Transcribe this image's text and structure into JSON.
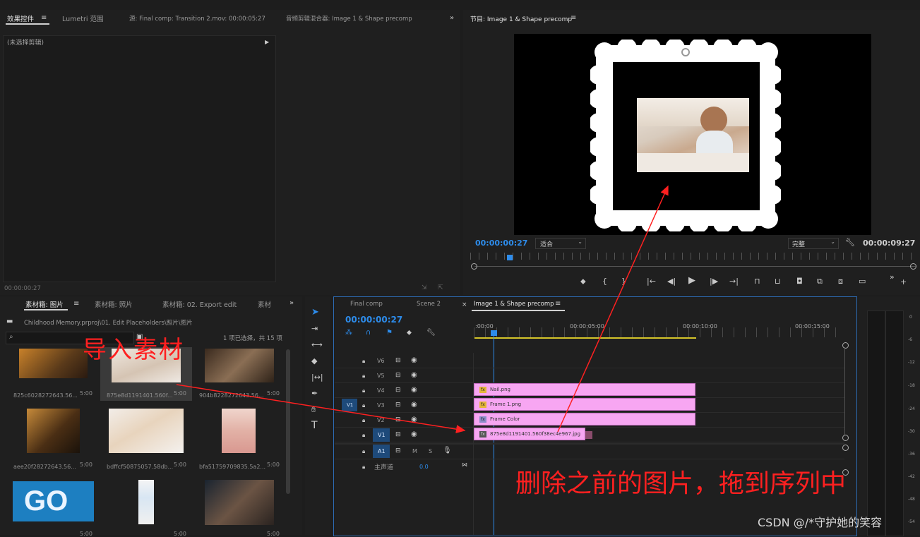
{
  "effect_panel": {
    "tabs": [
      "效果控件",
      "Lumetri 范围",
      "源: Final comp: Transition 2.mov: 00:00:05:27",
      "音频剪辑混合器: Image 1 & Shape precomp"
    ],
    "no_clip": "(未选择剪辑)",
    "timecode": "00:00:00:27"
  },
  "program": {
    "title": "节目: Image 1 & Shape precomp",
    "timecode": "00:00:00:27",
    "fit": "适合",
    "quality": "完整",
    "duration": "00:00:09:27"
  },
  "project": {
    "tabs": [
      "素材箱: 图片",
      "素材箱: 照片",
      "素材箱: 02. Export edit",
      "素材"
    ],
    "path": "Childhood Memory.prproj\\01. Edit Placeholders\\照片\\图片",
    "selection": "1 项已选择，共 15 项",
    "items": [
      {
        "name": "825c6028272643.56...",
        "dur": "5:00"
      },
      {
        "name": "875e8d1191401.560f...",
        "dur": "5:00"
      },
      {
        "name": "904b8228272643.56...",
        "dur": "5:00"
      },
      {
        "name": "aee20f28272643.56...",
        "dur": "5:00"
      },
      {
        "name": "bdffcf50875057.58db...",
        "dur": "5:00"
      },
      {
        "name": "bfa51759709835.5a2...",
        "dur": "5:00"
      },
      {
        "name": "",
        "dur": "5:00"
      },
      {
        "name": "",
        "dur": "5:00"
      },
      {
        "name": "",
        "dur": "5:00"
      }
    ]
  },
  "timeline": {
    "tabs": [
      "Final comp",
      "Scene 2",
      "Image 1 & Shape precomp"
    ],
    "timecode": "00:00:00:27",
    "ruler": [
      ":00:00",
      "00:00:05:00",
      "00:00:10:00",
      "00:00:15:00"
    ],
    "tracks": [
      "V6",
      "V5",
      "V4",
      "V3",
      "V2",
      "V1",
      "A1"
    ],
    "master": "主声道",
    "master_value": "0.0",
    "clips": [
      {
        "name": "Nail.png",
        "track": "V4"
      },
      {
        "name": "Frame 1.png",
        "track": "V3"
      },
      {
        "name": "Frame Color",
        "track": "V2"
      },
      {
        "name": "875e8d1191401.560f38ec4e967.jpg",
        "track": "V1"
      }
    ]
  },
  "annotations": {
    "import": "导入素材",
    "delete": "删除之前的图片，拖到序列中",
    "watermark": "CSDN @/*守护她的笑容"
  },
  "meter": {
    "labels": [
      "0",
      "-6",
      "-12",
      "-18",
      "-24",
      "-30",
      "-36",
      "-42",
      "-48",
      "-54"
    ]
  },
  "colors": {
    "accent": "#2d8ceb",
    "clip": "#f7a6f2",
    "annotation": "#ff2020"
  }
}
